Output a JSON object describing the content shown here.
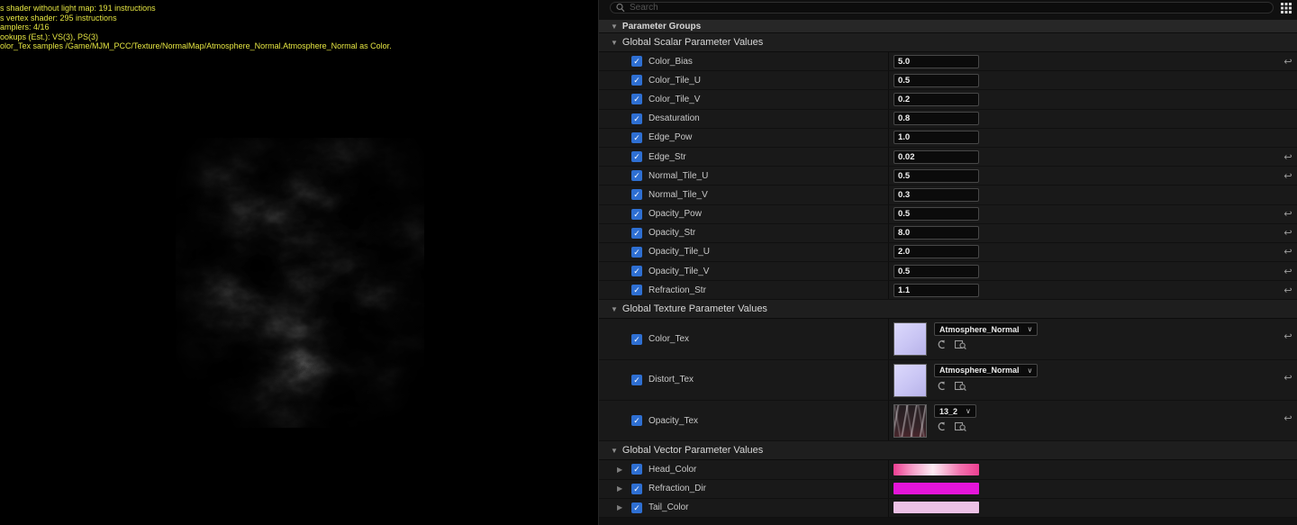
{
  "viewport": {
    "stats": [
      "s shader without light map: 191 instructions",
      "s vertex shader: 295 instructions",
      "amplers: 4/16",
      "ookups (Est.): VS(3), PS(3)",
      "olor_Tex samples /Game/MJM_PCC/Texture/NormalMap/Atmosphere_Normal.Atmosphere_Normal as Color."
    ]
  },
  "icons": {
    "check": "✓",
    "collapse": "▼",
    "expand": "▶",
    "dropdown": "∨",
    "reset": "↩"
  },
  "details": {
    "search_placeholder": "Search",
    "parameter_groups_label": "Parameter Groups",
    "sections": {
      "scalar": "Global Scalar Parameter Values",
      "texture": "Global Texture Parameter Values",
      "vector": "Global Vector Parameter Values"
    },
    "scalars": [
      {
        "name": "Color_Bias",
        "value": "5.0",
        "reset": true
      },
      {
        "name": "Color_Tile_U",
        "value": "0.5",
        "reset": false
      },
      {
        "name": "Color_Tile_V",
        "value": "0.2",
        "reset": false
      },
      {
        "name": "Desaturation",
        "value": "0.8",
        "reset": false
      },
      {
        "name": "Edge_Pow",
        "value": "1.0",
        "reset": false
      },
      {
        "name": "Edge_Str",
        "value": "0.02",
        "reset": true
      },
      {
        "name": "Normal_Tile_U",
        "value": "0.5",
        "reset": true
      },
      {
        "name": "Normal_Tile_V",
        "value": "0.3",
        "reset": false
      },
      {
        "name": "Opacity_Pow",
        "value": "0.5",
        "reset": true
      },
      {
        "name": "Opacity_Str",
        "value": "8.0",
        "reset": true
      },
      {
        "name": "Opacity_Tile_U",
        "value": "2.0",
        "reset": true
      },
      {
        "name": "Opacity_Tile_V",
        "value": "0.5",
        "reset": true
      },
      {
        "name": "Refraction_Str",
        "value": "1.1",
        "reset": true
      }
    ],
    "textures": [
      {
        "name": "Color_Tex",
        "asset": "Atmosphere_Normal",
        "reset": true
      },
      {
        "name": "Distort_Tex",
        "asset": "Atmosphere_Normal",
        "reset": true
      },
      {
        "name": "Opacity_Tex",
        "asset": "13_2",
        "reset": true
      }
    ],
    "vectors": [
      {
        "name": "Head_Color"
      },
      {
        "name": "Refraction_Dir"
      },
      {
        "name": "Tail_Color"
      }
    ],
    "colors": {
      "checkbox": "#2e6fd2",
      "stats_text": "#e6e642",
      "normal_map_thumb": "#c9c5f4",
      "head_color_gradient": [
        "#ee3f92",
        "#fdeaf3",
        "#ee3f92"
      ],
      "refraction_dir": "#e515d9",
      "tail_color": "#edc2e6"
    }
  }
}
